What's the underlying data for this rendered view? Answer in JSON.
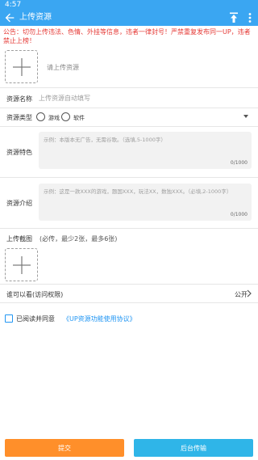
{
  "status_bar": {
    "time": "4:57"
  },
  "toolbar": {
    "title": "上传资源",
    "back_icon": "arrow-left-icon",
    "upload_icon": "upload-icon",
    "more_icon": "more-vertical-icon",
    "bg_color": "#3aa6f2"
  },
  "notice": {
    "text": "公告：切勿上传违法、色情、外挂等信息，违者一律封号！严禁重复发布同一UP，违者禁止上榜！",
    "color": "#e53935"
  },
  "cover": {
    "hint": "请上传资源",
    "icon": "plus-icon"
  },
  "form": {
    "name": {
      "label": "资源名称",
      "placeholder": "上传资源自动填写",
      "value": ""
    },
    "type": {
      "label": "资源类型",
      "options": [
        {
          "label": "游戏",
          "checked": false
        },
        {
          "label": "软件",
          "checked": false
        }
      ],
      "dropdown_icon": "caret-down-icon"
    },
    "feature": {
      "label": "资源特色",
      "placeholder": "示例：本版本无广告，无需谷歌。（选填,5-1000字）",
      "count": "0/1000"
    },
    "intro": {
      "label": "资源介绍",
      "placeholder": "示例：这是一款XXX的游戏，题国XXX，玩法XX，数独XXX。（必填,2-1000字）",
      "count": "0/1000"
    },
    "screenshots": {
      "label": "上传截图",
      "hint": "(必传，最少2张，最多6张)",
      "icon": "plus-icon"
    },
    "visibility": {
      "label": "谁可以看(访问权限)",
      "value": "公开",
      "icon": "chevron-right-icon"
    },
    "agreement": {
      "label": "已阅读并同意",
      "link": "《UP资源功能使用协议》",
      "checked": false
    }
  },
  "buttons": {
    "submit": {
      "label": "提交",
      "color": "#ff8f2a"
    },
    "background_upload": {
      "label": "后台传输",
      "color": "#2fb5e8"
    }
  }
}
